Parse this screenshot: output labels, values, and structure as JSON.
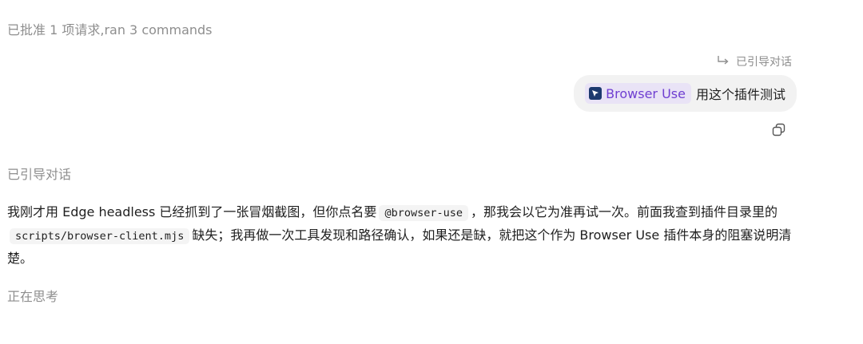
{
  "status_line": "已批准 1 项请求,ran 3 commands",
  "quoted_ref": {
    "label": "已引导对话",
    "icon": "reply-arrow-icon"
  },
  "user_message": {
    "plugin_chip": {
      "label": "Browser Use",
      "icon": "browser-use-icon",
      "color": "#6f3fd1",
      "background": "#e9e3f6"
    },
    "text": "用这个插件测试"
  },
  "copy_button": {
    "icon": "copy-icon"
  },
  "section_label": "已引导对话",
  "reply": {
    "p1_a": "我刚才用 Edge headless 已经抓到了一张冒烟截图，但你点名要",
    "code1": "@browser-use",
    "p1_b": "，那我会以它为准再试一次。前面我查到插件目录里的",
    "code2": "scripts/browser-client.mjs",
    "p1_c": "缺失；我再做一次工具发现和路径确认，如果还是缺，就把这个作为 Browser Use 插件本身的阻塞说明清楚。"
  },
  "thinking_label": "正在思考"
}
